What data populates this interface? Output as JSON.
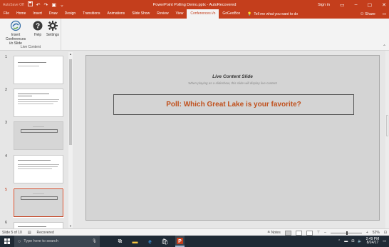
{
  "window": {
    "autosave_label": "AutoSave",
    "autosave_state": "Off",
    "title": "PowerPoint Polling Demo.pptx - AutoRecovered",
    "signin": "Sign in"
  },
  "tabs": [
    {
      "label": "File"
    },
    {
      "label": "Home"
    },
    {
      "label": "Insert"
    },
    {
      "label": "Draw"
    },
    {
      "label": "Design"
    },
    {
      "label": "Transitions"
    },
    {
      "label": "Animations"
    },
    {
      "label": "Slide Show"
    },
    {
      "label": "Review"
    },
    {
      "label": "View"
    },
    {
      "label": "Conferences i/o"
    },
    {
      "label": "GoGeoBox"
    }
  ],
  "tell_me": "Tell me what you want to do",
  "share_label": "Share",
  "ribbon": {
    "insert_btn_line1": "Insert Conferences",
    "insert_btn_line2": "i/o Slide",
    "help_btn": "Help",
    "settings_btn": "Settings",
    "group_label": "Live Content"
  },
  "thumbnails": [
    {
      "num": "1"
    },
    {
      "num": "2"
    },
    {
      "num": "3"
    },
    {
      "num": "4"
    },
    {
      "num": "5"
    },
    {
      "num": "6"
    }
  ],
  "slide": {
    "title": "Live Content Slide",
    "subtitle": "When playing as a slideshow, this slide will display live content",
    "poll_question": "Poll: Which Great Lake is your favorite?"
  },
  "status": {
    "slide_count": "Slide 5 of 10",
    "recovered": "Recovered",
    "notes": "Notes",
    "zoom": "52%",
    "zoom_level": 0.52
  },
  "taskbar": {
    "search_placeholder": "Type here to search",
    "time": "2:49 PM",
    "date": "8/24/17"
  },
  "colors": {
    "accent": "#c43e1c",
    "poll_text": "#c0501c",
    "taskbar": "#1f2a35"
  }
}
